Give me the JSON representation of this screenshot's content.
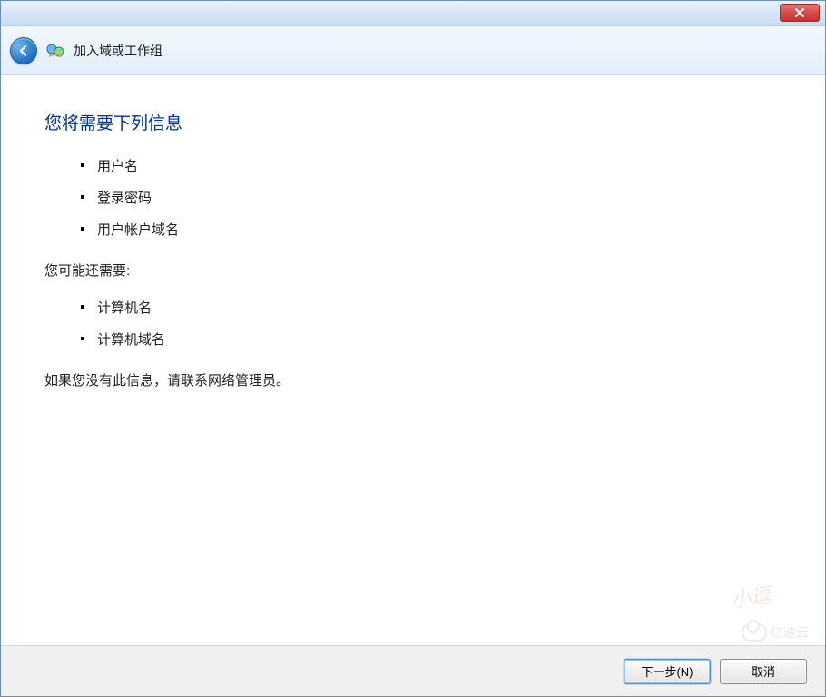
{
  "header": {
    "title": "加入域或工作组"
  },
  "page": {
    "heading": "您将需要下列信息",
    "required_items": [
      "用户名",
      "登录密码",
      "用户帐户域名"
    ],
    "optional_heading": "您可能还需要:",
    "optional_items": [
      "计算机名",
      "计算机域名"
    ],
    "note": "如果您没有此信息，请联系网络管理员。"
  },
  "footer": {
    "next_label": "下一步(N)",
    "cancel_label": "取消"
  },
  "watermark": {
    "brand": "亿速云",
    "script": "小逗"
  }
}
